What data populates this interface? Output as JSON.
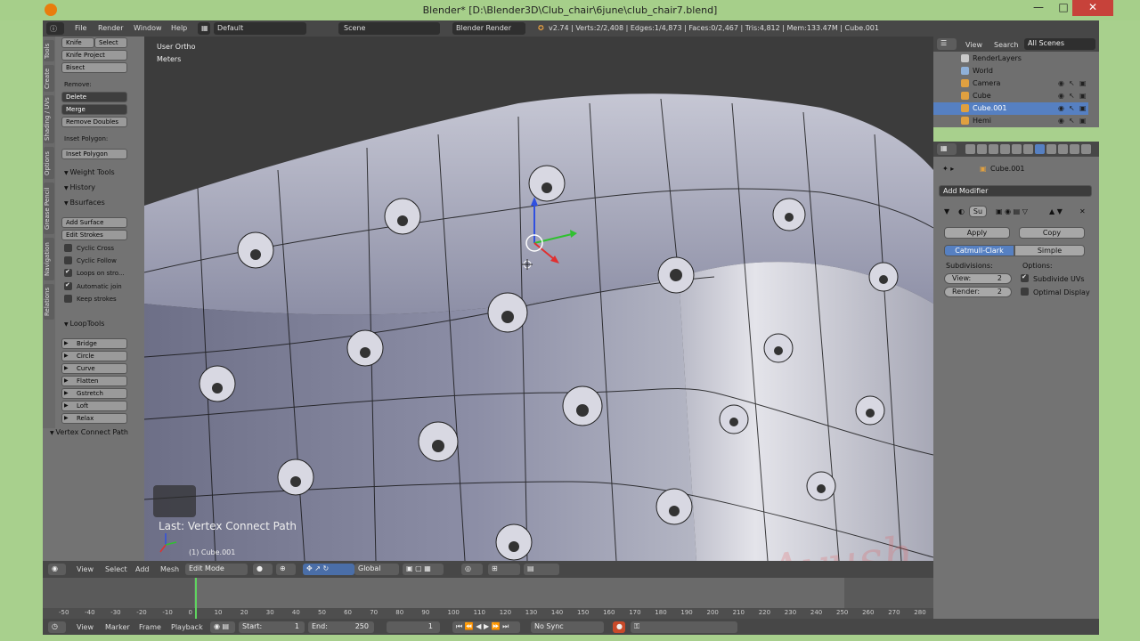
{
  "window": {
    "title": "Blender* [D:\\Blender3D\\Club_chair\\6june\\club_chair7.blend]",
    "min_glyph": "—",
    "max_glyph": "□",
    "close_glyph": "✕"
  },
  "menubar": {
    "items": [
      "File",
      "Render",
      "Window",
      "Help"
    ],
    "layout": "Default",
    "scene": "Scene",
    "engine": "Blender Render",
    "stats": "v2.74 | Verts:2/2,408 | Edges:1/4,873 | Faces:0/2,467 | Tris:4,812 | Mem:133.47M | Cube.001"
  },
  "toolpanel": {
    "tabs": [
      "Tools",
      "Create",
      "Shading / UVs",
      "Options",
      "Grease Pencil",
      "Navigation",
      "Relations"
    ],
    "knife": "Knife",
    "select": "Select",
    "knife_project": "Knife Project",
    "bisect": "Bisect",
    "remove_label": "Remove:",
    "delete": "Delete",
    "merge": "Merge",
    "remove_doubles": "Remove Doubles",
    "inset_label": "Inset Polygon:",
    "inset_button": "Inset Polygon",
    "weight_tools": "Weight Tools",
    "history": "History",
    "bsurfaces": "Bsurfaces",
    "add_surface": "Add Surface",
    "edit_strokes": "Edit Strokes",
    "cyclic_cross": "Cyclic Cross",
    "cyclic_follow": "Cyclic Follow",
    "loops_on_strokes": "Loops on stro...",
    "automatic_join": "Automatic join",
    "keep_strokes": "Keep strokes",
    "looptools": "LoopTools",
    "loop_items": [
      "Bridge",
      "Circle",
      "Curve",
      "Flatten",
      "Gstretch",
      "Loft",
      "Relax"
    ],
    "vertex_connect": "Vertex Connect Path"
  },
  "viewport": {
    "view_name": "User Ortho",
    "units": "Meters",
    "last_op": "Last: Vertex Connect Path",
    "object": "(1) Cube.001",
    "watermark": "Ayush"
  },
  "vpheader": {
    "view": "View",
    "select": "Select",
    "add": "Add",
    "mesh": "Mesh",
    "mode": "Edit Mode",
    "orientation": "Global"
  },
  "timeline": {
    "ticks": [
      "-50",
      "-40",
      "-30",
      "-20",
      "-10",
      "0",
      "10",
      "20",
      "30",
      "40",
      "50",
      "60",
      "70",
      "80",
      "90",
      "100",
      "110",
      "120",
      "130",
      "140",
      "150",
      "160",
      "170",
      "180",
      "190",
      "200",
      "210",
      "220",
      "230",
      "240",
      "250",
      "260",
      "270",
      "280"
    ]
  },
  "bottombar": {
    "view": "View",
    "marker": "Marker",
    "frame": "Frame",
    "playback": "Playback",
    "start_label": "Start:",
    "start_value": "1",
    "end_label": "End:",
    "end_value": "250",
    "current": "1",
    "sync": "No Sync"
  },
  "outliner": {
    "view": "View",
    "search": "Search",
    "scenes": "All Scenes",
    "rows": [
      {
        "name": "RenderLayers",
        "color": "#c9c9c9"
      },
      {
        "name": "World",
        "color": "#8fb0d8"
      },
      {
        "name": "Camera",
        "color": "#e0a040"
      },
      {
        "name": "Cube",
        "color": "#e0a040"
      },
      {
        "name": "Cube.001",
        "color": "#e0a040"
      },
      {
        "name": "Hemi",
        "color": "#e0a040"
      }
    ]
  },
  "properties": {
    "object": "Cube.001",
    "add_modifier": "Add Modifier",
    "modifier_short": "Su",
    "apply": "Apply",
    "copy": "Copy",
    "catmull": "Catmull-Clark",
    "simple": "Simple",
    "subdivisions": "Subdivisions:",
    "options": "Options:",
    "view_label": "View:",
    "view_value": "2",
    "render_label": "Render:",
    "render_value": "2",
    "subdivide_uvs": "Subdivide UVs",
    "optimal_display": "Optimal Display"
  }
}
